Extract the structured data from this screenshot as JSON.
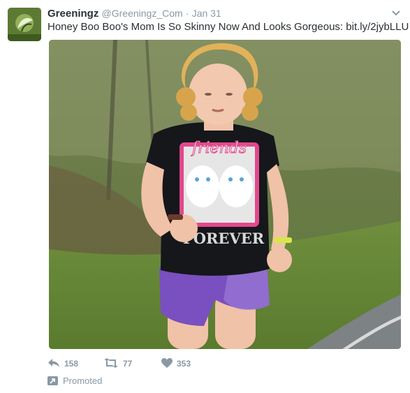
{
  "tweet": {
    "display_name": "Greeningz",
    "handle": "@Greeningz_Com",
    "separator": "·",
    "timestamp": "Jan 31",
    "text_prefix": "Honey Boo Boo's Mom Is So Skinny Now And Looks Gorgeous: ",
    "link_text": "bit.ly/2jybLLU",
    "image_text": {
      "top": "friends",
      "bottom": "FOREVER"
    },
    "actions": {
      "reply_icon": "reply-icon",
      "reply_count": "158",
      "retweet_icon": "retweet-icon",
      "retweet_count": "77",
      "like_icon": "heart-icon",
      "like_count": "353"
    },
    "promoted_label": "Promoted",
    "colors": {
      "text": "#292f33",
      "muted": "#8899a6",
      "background": "#ffffff"
    }
  }
}
